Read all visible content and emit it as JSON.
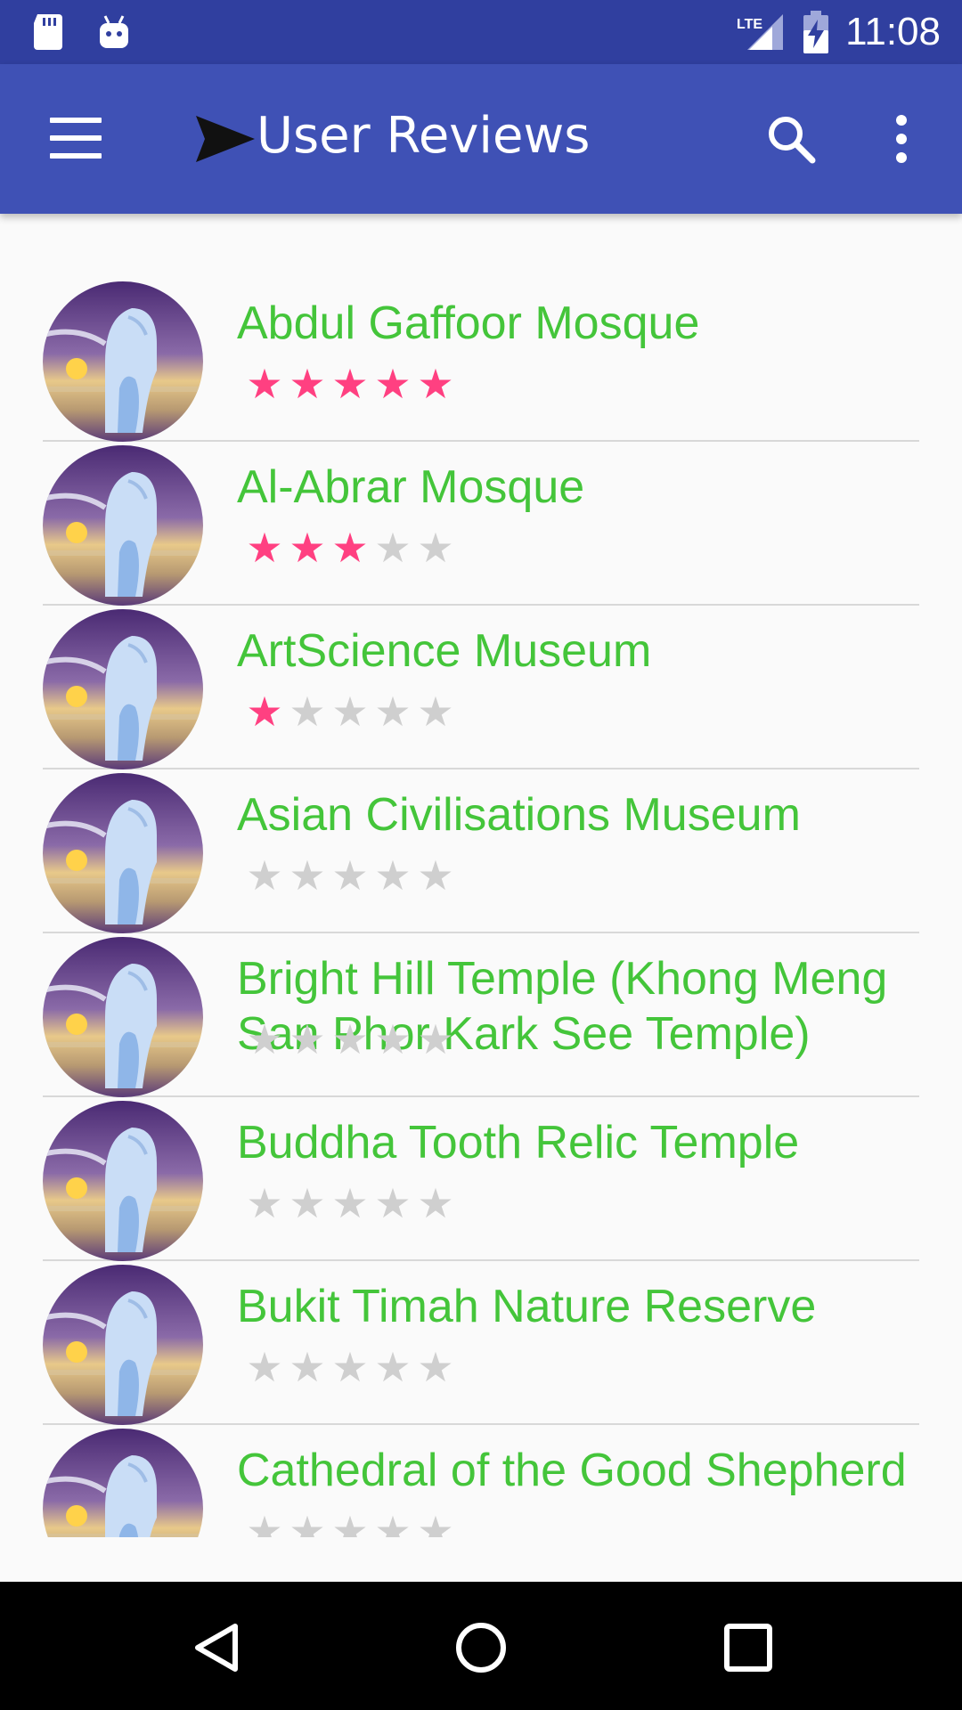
{
  "status_bar": {
    "time": "11:08",
    "network": "LTE",
    "icons": [
      "sd-card-icon",
      "android-icon",
      "lte-signal-icon",
      "battery-charging-icon"
    ]
  },
  "app_bar": {
    "title": "User Reviews",
    "icons": [
      "menu-icon",
      "send-icon",
      "search-icon",
      "more-vert-icon"
    ]
  },
  "colors": {
    "status_bar": "#303f9f",
    "app_bar": "#3f51b5",
    "place_name": "#44c53a",
    "star_on": "#ff4081",
    "star_off": "#cfcfcf"
  },
  "reviews": [
    {
      "name": "Abdul Gaffoor Mosque",
      "rating": 5
    },
    {
      "name": "Al-Abrar Mosque",
      "rating": 3
    },
    {
      "name": "ArtScience Museum",
      "rating": 1
    },
    {
      "name": "Asian Civilisations Museum",
      "rating": 0
    },
    {
      "name": "Bright Hill Temple (Khong Meng San Phor Kark See Temple)",
      "rating": 0
    },
    {
      "name": "Buddha Tooth Relic Temple",
      "rating": 0
    },
    {
      "name": "Bukit Timah Nature Reserve",
      "rating": 0
    },
    {
      "name": "Cathedral of the Good Shepherd",
      "rating": 0
    }
  ],
  "max_rating": 5,
  "nav_bar": {
    "icons": [
      "back-icon",
      "home-icon",
      "recents-icon"
    ]
  }
}
